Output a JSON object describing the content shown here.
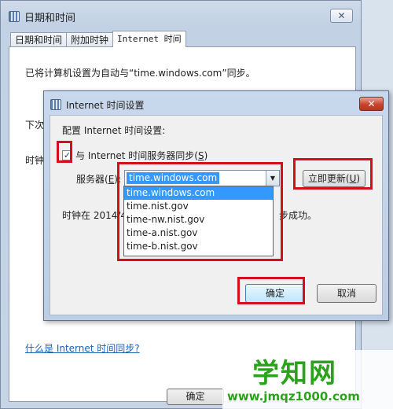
{
  "outer": {
    "title": "日期和时间",
    "close": "✕",
    "tabs": [
      "日期和时间",
      "附加时钟",
      "Internet 时间"
    ],
    "message": "已将计算机设置为自动与“time.windows.com”同步。",
    "fragment_next": "下次",
    "fragment_clock": "时钟",
    "help_link": "什么是 Internet 时间同步?",
    "ok_label": "确定"
  },
  "dialog": {
    "title": "Internet 时间设置",
    "close": "✕",
    "config_label": "配置 Internet 时间设置:",
    "checkbox": {
      "checked": true,
      "mark": "✓",
      "text": "与 Internet 时间服务器同步(",
      "accel": "S",
      "text_end": ")"
    },
    "server": {
      "label": "服务器(",
      "accel": "E",
      "label_end": "):",
      "value": "time.windows.com",
      "arrow": "▼"
    },
    "update_button": {
      "text": "立即更新(",
      "accel": "U",
      "text_end": ")"
    },
    "sync_status_start": "时钟在 2014/4",
    "sync_status_end": "步成功。",
    "ok_label": "确定",
    "cancel_label": "取消"
  },
  "dropdown": {
    "items": [
      "time.windows.com",
      "time.nist.gov",
      "time-nw.nist.gov",
      "time-a.nist.gov",
      "time-b.nist.gov"
    ],
    "selected": "time.windows.com"
  },
  "watermark": {
    "text": "学知网",
    "url": "www.jmqz1000.com"
  },
  "colors": {
    "annotation": "#d40f1c",
    "selection": "#3399ff",
    "watermark": "#2aa21b",
    "dialog_close": "#c8432c"
  }
}
